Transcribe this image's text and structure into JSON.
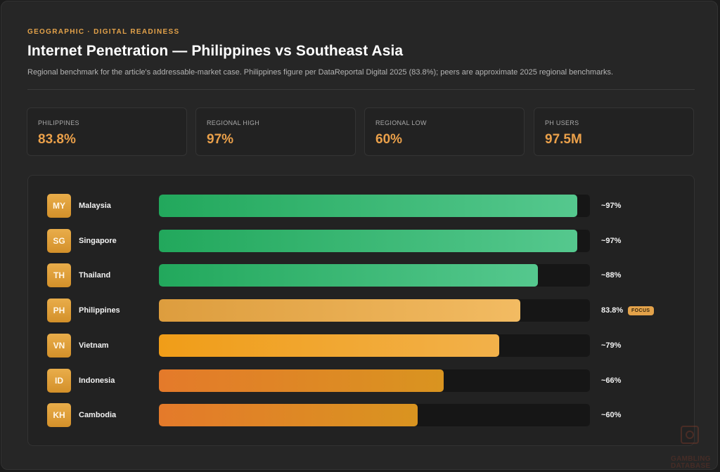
{
  "header": {
    "eyebrow": "GEOGRAPHIC · DIGITAL READINESS",
    "title": "Internet Penetration — Philippines vs Southeast Asia",
    "subtitle": "Regional benchmark for the article's addressable-market case. Philippines figure per DataReportal Digital 2025 (83.8%); peers are approximate 2025 regional benchmarks."
  },
  "stats": [
    {
      "label": "PHILIPPINES",
      "value": "83.8%"
    },
    {
      "label": "REGIONAL HIGH",
      "value": "97%"
    },
    {
      "label": "REGIONAL LOW",
      "value": "60%"
    },
    {
      "label": "PH USERS",
      "value": "97.5M"
    }
  ],
  "colors": {
    "accent": "#e3a24a",
    "green": "#2fb06a",
    "focus": "#e8a84a",
    "amber": "#f0a020",
    "orange": "#e6822a"
  },
  "chart_data": {
    "type": "bar",
    "orientation": "horizontal",
    "xlim": [
      0,
      100
    ],
    "categories": [
      "Malaysia",
      "Singapore",
      "Thailand",
      "Philippines",
      "Vietnam",
      "Indonesia",
      "Cambodia"
    ],
    "codes": [
      "MY",
      "SG",
      "TH",
      "PH",
      "VN",
      "ID",
      "KH"
    ],
    "values": [
      97,
      97,
      88,
      83.8,
      79,
      66,
      60
    ],
    "value_labels": [
      "~97%",
      "~97%",
      "~88%",
      "83.8%",
      "~79%",
      "~66%",
      "~60%"
    ],
    "bar_colors": [
      "green",
      "green",
      "green",
      "focus",
      "amber",
      "orange",
      "orange"
    ],
    "focus_index": 3,
    "focus_label": "FOCUS"
  },
  "watermark": {
    "text_line1": "GAMBLING",
    "text_line2": "DATABASE"
  }
}
